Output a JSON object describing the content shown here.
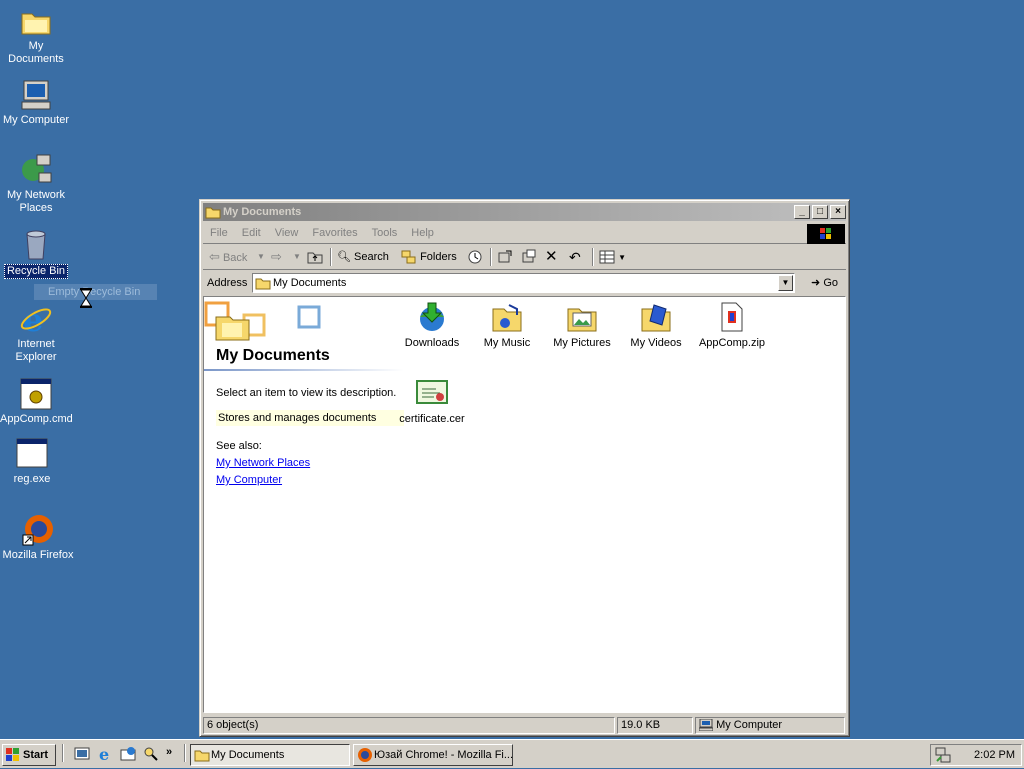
{
  "desktop": {
    "icons": [
      {
        "label": "My Documents"
      },
      {
        "label": "My Computer"
      },
      {
        "label": "My Network Places"
      },
      {
        "label": "Recycle Bin"
      },
      {
        "label": "Internet Explorer"
      },
      {
        "label": "AppComp.cmd"
      },
      {
        "label": "reg.exe"
      },
      {
        "label": "Mozilla Firefox"
      }
    ],
    "context_ghost": "Empty Recycle Bin"
  },
  "window": {
    "title": "My Documents",
    "menu": [
      "File",
      "Edit",
      "View",
      "Favorites",
      "Tools",
      "Help"
    ],
    "toolbar": {
      "back": "Back",
      "search": "Search",
      "folders": "Folders"
    },
    "address": {
      "label": "Address",
      "value": "My Documents",
      "go": "Go"
    },
    "left_pane": {
      "title": "My Documents",
      "description": "Select an item to view its description.",
      "status": "Stores and manages documents",
      "see_also": "See also:",
      "links": [
        "My Network Places",
        "My Computer"
      ]
    },
    "files": [
      {
        "name": "Downloads",
        "icon": "downloads-folder-icon"
      },
      {
        "name": "My Music",
        "icon": "music-folder-icon"
      },
      {
        "name": "My Pictures",
        "icon": "pictures-folder-icon"
      },
      {
        "name": "My Videos",
        "icon": "videos-folder-icon"
      },
      {
        "name": "AppComp.zip",
        "icon": "zip-file-icon"
      },
      {
        "name": "certificate.cer",
        "icon": "certificate-icon"
      }
    ],
    "status": {
      "objects": "6 object(s)",
      "size": "19.0 KB",
      "zone": "My Computer"
    }
  },
  "taskbar": {
    "start": "Start",
    "tasks": [
      "My Documents",
      "Юзай Chrome! - Mozilla Fi..."
    ],
    "clock": "2:02 PM"
  },
  "colors": {
    "desktop": "#3a6ea5",
    "face": "#d4d0c8",
    "link": "#0000ee",
    "inactive_title_start": "#808080"
  }
}
